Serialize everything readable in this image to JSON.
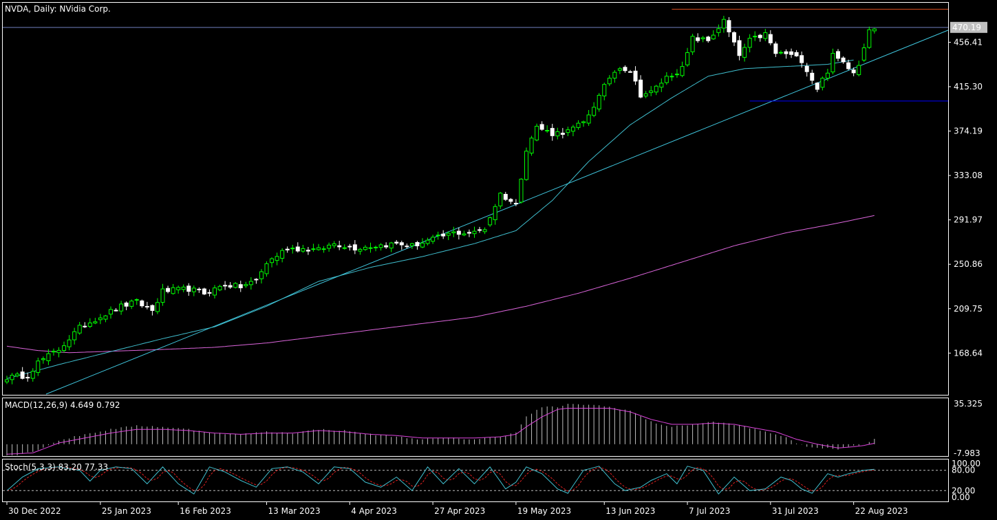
{
  "panels": {
    "main_title": "NVDA, Daily:  NVidia Corp.",
    "macd_title": "MACD(12,26,9) 4.649 0.792",
    "stoch_title": "Stoch(5,3,3) 83.20 77.33"
  },
  "colors": {
    "background": "#000000",
    "frame": "#ffffff",
    "candle_up": "#00ff00",
    "candle_down": "#ffffff",
    "ma_fast": "#40c0d0",
    "ma_slow": "#dd66dd",
    "trendline": "#40c8e0",
    "resistance": "#e05020",
    "support": "#0000ff",
    "bid_line": "#7080c0",
    "price_tag_bg": "#c0c0c0",
    "macd_hist": "#c0c0c0",
    "macd_signal": "#dd44dd",
    "stoch_main": "#40c0d0",
    "stoch_signal": "#e02020"
  },
  "chart_data": [
    {
      "type": "candlestick",
      "symbol": "NVDA",
      "timeframe": "Daily",
      "ylim": [
        130,
        493
      ],
      "y_ticks": [
        "470.19",
        "456.41",
        "415.30",
        "374.19",
        "333.08",
        "291.97",
        "250.86",
        "209.75",
        "168.64"
      ],
      "current_price": "470.19",
      "x_ticks": [
        "30 Dec 2022",
        "25 Jan 2023",
        "16 Feb 2023",
        "13 Mar 2023",
        "4 Apr 2023",
        "27 Apr 2023",
        "19 May 2023",
        "13 Jun 2023",
        "7 Jul 2023",
        "31 Jul 2023",
        "22 Aug 2023"
      ],
      "x_tick_index": [
        0,
        18,
        33,
        50,
        66,
        82,
        98,
        115,
        131,
        147,
        163
      ],
      "bars_count": 168,
      "close_keypoints": [
        [
          0,
          146
        ],
        [
          4,
          148
        ],
        [
          6,
          160
        ],
        [
          10,
          172
        ],
        [
          14,
          192
        ],
        [
          17,
          200
        ],
        [
          22,
          212
        ],
        [
          25,
          216
        ],
        [
          28,
          208
        ],
        [
          30,
          226
        ],
        [
          35,
          228
        ],
        [
          38,
          224
        ],
        [
          42,
          232
        ],
        [
          45,
          230
        ],
        [
          48,
          236
        ],
        [
          50,
          252
        ],
        [
          54,
          266
        ],
        [
          60,
          264
        ],
        [
          63,
          270
        ],
        [
          67,
          266
        ],
        [
          71,
          268
        ],
        [
          75,
          270
        ],
        [
          78,
          268
        ],
        [
          82,
          274
        ],
        [
          86,
          280
        ],
        [
          90,
          280
        ],
        [
          92,
          284
        ],
        [
          95,
          316
        ],
        [
          98,
          306
        ],
        [
          100,
          358
        ],
        [
          102,
          378
        ],
        [
          105,
          372
        ],
        [
          108,
          374
        ],
        [
          111,
          382
        ],
        [
          114,
          406
        ],
        [
          116,
          424
        ],
        [
          118,
          434
        ],
        [
          120,
          430
        ],
        [
          122,
          408
        ],
        [
          124,
          410
        ],
        [
          127,
          424
        ],
        [
          130,
          432
        ],
        [
          132,
          460
        ],
        [
          135,
          458
        ],
        [
          138,
          476
        ],
        [
          141,
          444
        ],
        [
          143,
          458
        ],
        [
          146,
          464
        ],
        [
          148,
          446
        ],
        [
          150,
          446
        ],
        [
          153,
          440
        ],
        [
          155,
          422
        ],
        [
          156,
          414
        ],
        [
          158,
          430
        ],
        [
          159,
          444
        ],
        [
          161,
          438
        ],
        [
          163,
          430
        ],
        [
          164,
          436
        ],
        [
          166,
          470
        ],
        [
          167,
          470
        ]
      ],
      "events": [
        [
          93,
          0.6
        ],
        [
          123,
          0.7
        ],
        [
          124,
          0.6
        ],
        [
          137,
          0.6
        ],
        [
          154,
          0.6
        ],
        [
          156,
          0.7
        ],
        [
          163,
          0.7
        ],
        [
          165,
          0.7
        ]
      ],
      "ma_fast": [
        [
          0,
          145
        ],
        [
          10,
          158
        ],
        [
          20,
          170
        ],
        [
          30,
          182
        ],
        [
          40,
          193
        ],
        [
          50,
          212
        ],
        [
          60,
          235
        ],
        [
          70,
          248
        ],
        [
          80,
          258
        ],
        [
          90,
          270
        ],
        [
          98,
          282
        ],
        [
          105,
          310
        ],
        [
          112,
          346
        ],
        [
          120,
          380
        ],
        [
          128,
          405
        ],
        [
          135,
          425
        ],
        [
          142,
          432
        ],
        [
          150,
          434
        ],
        [
          158,
          436
        ],
        [
          163,
          440
        ]
      ],
      "ma_slow": [
        [
          0,
          175
        ],
        [
          6,
          171
        ],
        [
          12,
          169
        ],
        [
          18,
          170
        ],
        [
          30,
          172
        ],
        [
          40,
          174
        ],
        [
          50,
          178
        ],
        [
          60,
          184
        ],
        [
          70,
          190
        ],
        [
          80,
          196
        ],
        [
          90,
          202
        ],
        [
          100,
          212
        ],
        [
          110,
          224
        ],
        [
          120,
          238
        ],
        [
          130,
          253
        ],
        [
          140,
          268
        ],
        [
          150,
          280
        ],
        [
          160,
          289
        ],
        [
          167,
          296
        ]
      ],
      "trendline": [
        [
          0,
          116
        ],
        [
          168,
          442
        ]
      ],
      "resistance": {
        "value": 487,
        "from": 128,
        "to": 168
      },
      "support": {
        "value": 402,
        "from": 143,
        "to": 168
      }
    },
    {
      "type": "macd",
      "params": "12,26,9",
      "main": 4.649,
      "signal": 0.792,
      "ylim": [
        -9.5,
        37
      ],
      "y_ticks": [
        "35.325",
        "-7.983"
      ],
      "hist_keypoints": [
        [
          0,
          -10
        ],
        [
          5,
          -6
        ],
        [
          10,
          3
        ],
        [
          15,
          8
        ],
        [
          20,
          12
        ],
        [
          25,
          15
        ],
        [
          30,
          14
        ],
        [
          35,
          12
        ],
        [
          40,
          9
        ],
        [
          45,
          8
        ],
        [
          50,
          10
        ],
        [
          55,
          9
        ],
        [
          60,
          12
        ],
        [
          65,
          11
        ],
        [
          70,
          8
        ],
        [
          75,
          6
        ],
        [
          80,
          4
        ],
        [
          85,
          5
        ],
        [
          90,
          4
        ],
        [
          95,
          6
        ],
        [
          98,
          10
        ],
        [
          100,
          22
        ],
        [
          103,
          30
        ],
        [
          106,
          30
        ],
        [
          108,
          32
        ],
        [
          112,
          32
        ],
        [
          116,
          30
        ],
        [
          120,
          27
        ],
        [
          124,
          18
        ],
        [
          128,
          14
        ],
        [
          132,
          16
        ],
        [
          136,
          18
        ],
        [
          140,
          16
        ],
        [
          144,
          12
        ],
        [
          148,
          8
        ],
        [
          150,
          6
        ],
        [
          152,
          0
        ],
        [
          156,
          -3
        ],
        [
          160,
          -4
        ],
        [
          163,
          -1
        ],
        [
          165,
          0
        ],
        [
          167,
          4.6
        ]
      ],
      "signal_keypoints": [
        [
          0,
          -8
        ],
        [
          5,
          -7
        ],
        [
          10,
          1
        ],
        [
          15,
          5
        ],
        [
          20,
          9
        ],
        [
          25,
          12
        ],
        [
          30,
          12
        ],
        [
          35,
          11
        ],
        [
          40,
          9
        ],
        [
          45,
          8
        ],
        [
          50,
          9
        ],
        [
          55,
          9
        ],
        [
          60,
          11
        ],
        [
          65,
          10
        ],
        [
          70,
          8
        ],
        [
          75,
          7
        ],
        [
          80,
          5
        ],
        [
          85,
          5
        ],
        [
          90,
          5
        ],
        [
          95,
          6
        ],
        [
          98,
          8
        ],
        [
          100,
          14
        ],
        [
          103,
          22
        ],
        [
          106,
          28
        ],
        [
          108,
          29
        ],
        [
          112,
          29
        ],
        [
          116,
          29
        ],
        [
          120,
          26
        ],
        [
          124,
          20
        ],
        [
          128,
          16
        ],
        [
          132,
          16
        ],
        [
          136,
          17
        ],
        [
          140,
          16
        ],
        [
          144,
          13
        ],
        [
          148,
          10
        ],
        [
          150,
          7
        ],
        [
          152,
          4
        ],
        [
          156,
          0
        ],
        [
          160,
          -3
        ],
        [
          163,
          -2
        ],
        [
          165,
          -1
        ],
        [
          167,
          0.8
        ]
      ]
    },
    {
      "type": "stochastic",
      "params": "5,3,3",
      "main": 83.2,
      "signal": 77.33,
      "ylim": [
        -12,
        112
      ],
      "levels": [
        80,
        20
      ],
      "y_ticks": [
        "100.00",
        "80.00",
        "20.00",
        "0.00"
      ],
      "main_keypoints": [
        [
          0,
          20
        ],
        [
          3,
          60
        ],
        [
          6,
          85
        ],
        [
          10,
          90
        ],
        [
          14,
          80
        ],
        [
          16,
          48
        ],
        [
          18,
          80
        ],
        [
          21,
          90
        ],
        [
          24,
          85
        ],
        [
          27,
          40
        ],
        [
          30,
          90
        ],
        [
          33,
          40
        ],
        [
          36,
          10
        ],
        [
          39,
          90
        ],
        [
          42,
          75
        ],
        [
          45,
          50
        ],
        [
          48,
          30
        ],
        [
          51,
          85
        ],
        [
          54,
          90
        ],
        [
          57,
          75
        ],
        [
          60,
          40
        ],
        [
          63,
          90
        ],
        [
          66,
          85
        ],
        [
          69,
          45
        ],
        [
          72,
          30
        ],
        [
          75,
          60
        ],
        [
          78,
          20
        ],
        [
          81,
          90
        ],
        [
          84,
          40
        ],
        [
          87,
          85
        ],
        [
          90,
          40
        ],
        [
          93,
          90
        ],
        [
          96,
          25
        ],
        [
          98,
          45
        ],
        [
          100,
          90
        ],
        [
          103,
          70
        ],
        [
          106,
          25
        ],
        [
          108,
          12
        ],
        [
          111,
          80
        ],
        [
          114,
          92
        ],
        [
          117,
          40
        ],
        [
          119,
          20
        ],
        [
          122,
          30
        ],
        [
          124,
          50
        ],
        [
          127,
          70
        ],
        [
          129,
          40
        ],
        [
          131,
          92
        ],
        [
          134,
          80
        ],
        [
          137,
          10
        ],
        [
          140,
          60
        ],
        [
          143,
          20
        ],
        [
          146,
          25
        ],
        [
          149,
          60
        ],
        [
          151,
          50
        ],
        [
          153,
          25
        ],
        [
          155,
          12
        ],
        [
          158,
          70
        ],
        [
          160,
          60
        ],
        [
          162,
          70
        ],
        [
          165,
          80
        ],
        [
          167,
          83.2
        ]
      ]
    }
  ]
}
